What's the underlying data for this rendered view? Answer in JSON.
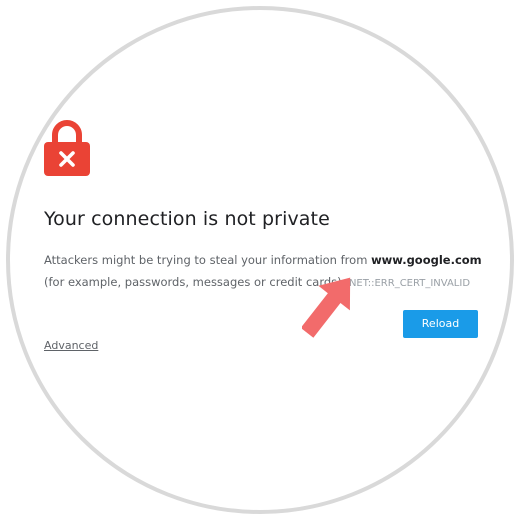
{
  "interstitial": {
    "title": "Your connection is not private",
    "desc_prefix": "Attackers might be trying to steal your information from ",
    "domain": "www.google.com",
    "desc_suffix": " (for example, passwords, messages or credit cards). ",
    "error_code": "NET::ERR_CERT_INVALID",
    "reload_label": "Reload",
    "advanced_label": "Advanced"
  },
  "icons": {
    "lock": "lock-x-icon",
    "arrow": "annotation-arrow-icon"
  },
  "colors": {
    "lock_red": "#ea4335",
    "button_blue": "#1a9be8",
    "arrow_coral": "#f26b6b",
    "frame_gray": "#d9d9d9"
  }
}
